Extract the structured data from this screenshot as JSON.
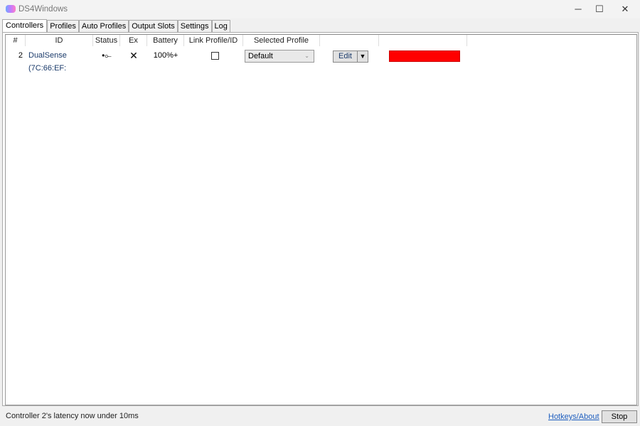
{
  "window": {
    "title": "DS4Windows",
    "icon": "gamepad-icon",
    "minimize": "─",
    "maximize": "☐",
    "close": "✕"
  },
  "tabs": [
    "Controllers",
    "Profiles",
    "Auto Profiles",
    "Output Slots",
    "Settings",
    "Log"
  ],
  "columns": [
    "#",
    "ID",
    "Status",
    "Ex",
    "Battery",
    "Link Profile/ID",
    "Selected Profile",
    "",
    ""
  ],
  "row": {
    "num": "2",
    "id": "DualSense (7C:66:EF:",
    "status_icon": "usb-icon",
    "status": "•⟜",
    "ex": "✕",
    "battery": "100%+",
    "linked": false,
    "profile": "Default",
    "edit": "Edit",
    "dropdown": "▼",
    "light_color": "#ff0000"
  },
  "footer": {
    "status": "Controller 2's latency now under 10ms",
    "hotkeys": "Hotkeys/About",
    "stop": "Stop"
  }
}
